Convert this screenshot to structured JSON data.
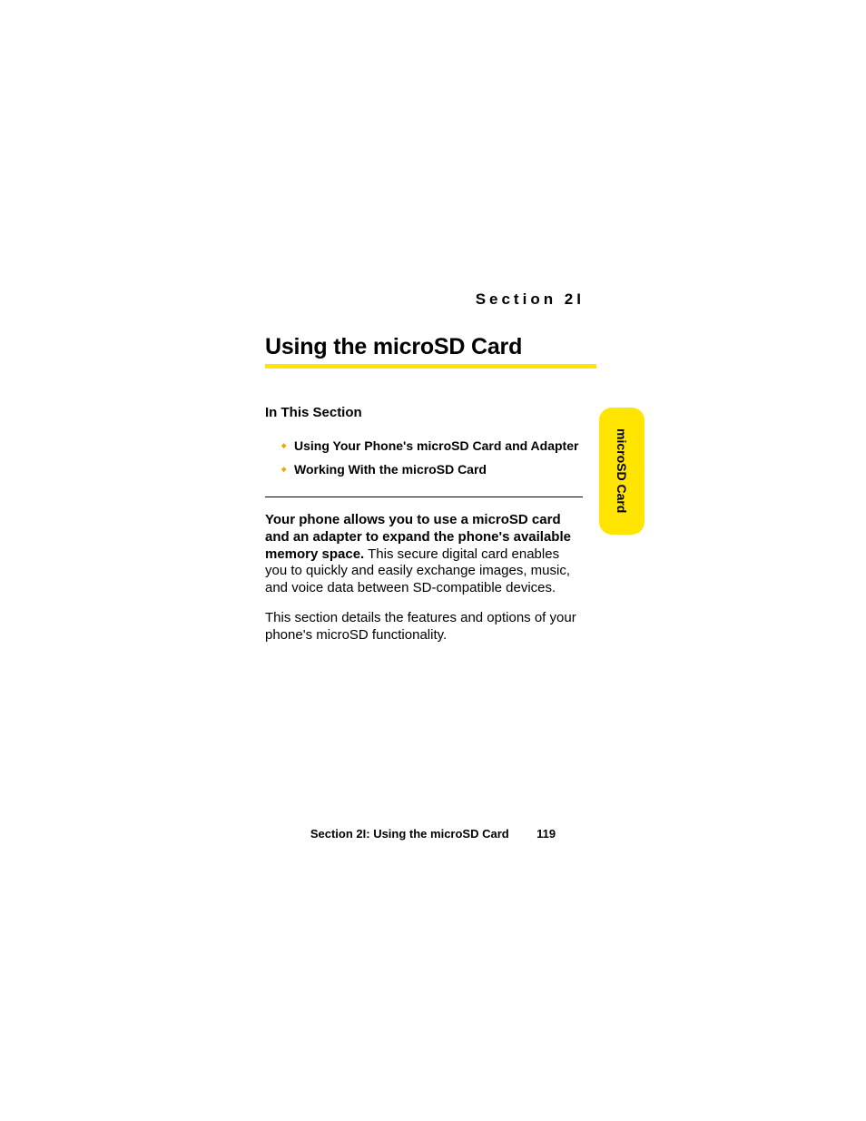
{
  "section_label": "Section 2I",
  "title": "Using the microSD Card",
  "in_this_section_label": "In This Section",
  "toc": [
    "Using Your Phone's microSD Card and Adapter",
    "Working With the microSD Card"
  ],
  "para1_lead": "Your phone allows you to use a microSD card and an adapter to expand the phone's available memory space.",
  "para1_rest": " This secure digital card enables you to quickly and easily exchange images, music, and voice data between SD-compatible devices.",
  "para2": "This section details the features and options of your phone's microSD functionality.",
  "side_tab": "microSD Card",
  "footer_label": "Section 2I: Using the microSD Card",
  "page_number": "119"
}
